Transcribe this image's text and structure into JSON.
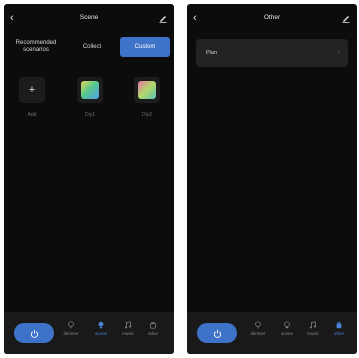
{
  "left": {
    "title": "Scene",
    "segments": {
      "recommended": "Recommended scenarios",
      "collect": "Collect",
      "custom": "Custom"
    },
    "tiles": [
      {
        "label": "Add",
        "icon": "plus-icon"
      },
      {
        "label": "Diy1",
        "icon": "gradient-scene-icon"
      },
      {
        "label": "Diy2",
        "icon": "gradient-scene-icon"
      }
    ],
    "nav": [
      "dimmer",
      "scene",
      "music",
      "other"
    ],
    "active_nav": "scene"
  },
  "right": {
    "title": "Other",
    "item": "Plan",
    "nav": [
      "dimmer",
      "scene",
      "music",
      "other"
    ],
    "active_nav": "other"
  },
  "colors": {
    "accent": "#3f73c9",
    "background": "#0c0c0c",
    "nav_bar": "#191919",
    "card": "#222222"
  }
}
